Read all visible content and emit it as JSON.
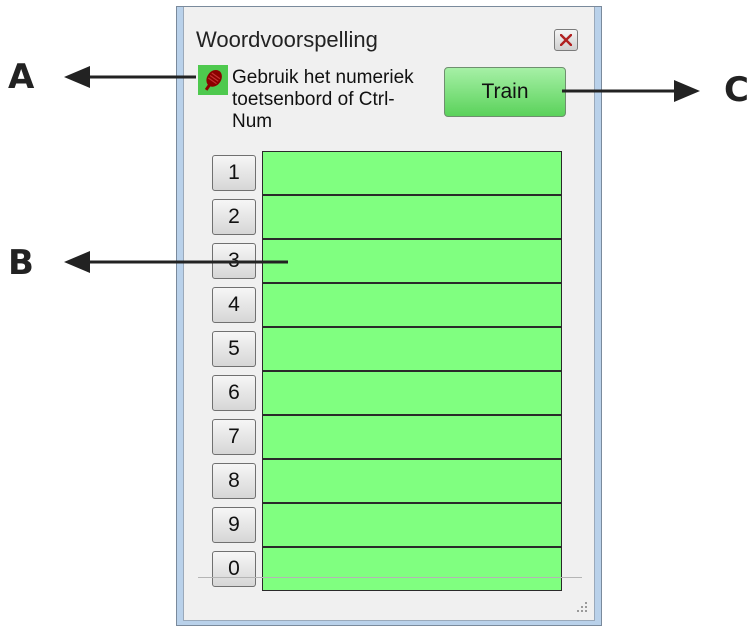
{
  "callouts": {
    "a": "A",
    "b": "B",
    "c": "C"
  },
  "window": {
    "title": "Woordvoorspelling",
    "close_icon": "close-icon"
  },
  "toolbar": {
    "mic_icon": "microphone-icon",
    "hint": "Gebruik het numeriek\ntoetsenbord of Ctrl-\nNum",
    "train_label": "Train"
  },
  "predictions": {
    "rows": [
      {
        "key": "1",
        "word": ""
      },
      {
        "key": "2",
        "word": ""
      },
      {
        "key": "3",
        "word": ""
      },
      {
        "key": "4",
        "word": ""
      },
      {
        "key": "5",
        "word": ""
      },
      {
        "key": "6",
        "word": ""
      },
      {
        "key": "7",
        "word": ""
      },
      {
        "key": "8",
        "word": ""
      },
      {
        "key": "9",
        "word": ""
      },
      {
        "key": "0",
        "word": ""
      }
    ]
  },
  "colors": {
    "prediction_fill": "#80ff80",
    "train_button": "#5bd25b",
    "mic_background": "#4ec94e",
    "mic_icon": "#8b0000"
  }
}
